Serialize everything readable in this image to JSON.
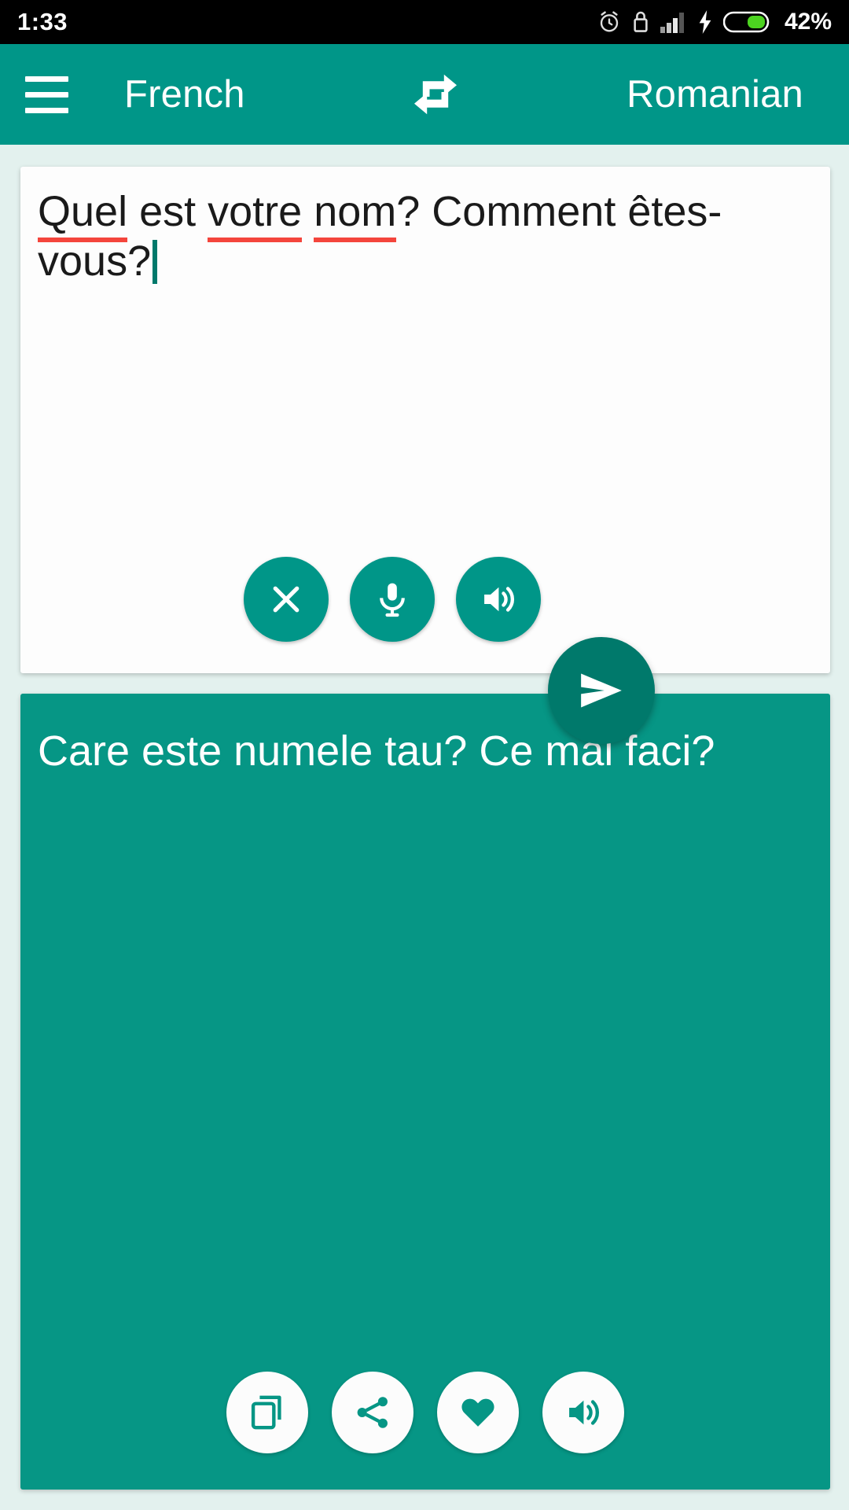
{
  "status_bar": {
    "time": "1:33",
    "battery_percent": "42%",
    "icons": [
      "alarm-icon",
      "lock-icon",
      "signal-bars-icon",
      "charging-bolt-icon",
      "battery-icon"
    ],
    "battery_fill_color": "#4CD320",
    "background": "#000000"
  },
  "app_bar": {
    "menu_icon": "hamburger-menu-icon",
    "source_language": "French",
    "swap_icon": "swap-languages-icon",
    "target_language": "Romanian",
    "background": "#009688"
  },
  "source_card": {
    "text_segments": [
      {
        "text": "Quel",
        "misspelled": true
      },
      {
        "text": " est ",
        "misspelled": false
      },
      {
        "text": "votre",
        "misspelled": true
      },
      {
        "text": " ",
        "misspelled": false
      },
      {
        "text": "nom",
        "misspelled": true
      },
      {
        "text": "? Comment ",
        "misspelled": false
      },
      {
        "text": "êtes-vous",
        "misspelled": true
      },
      {
        "text": "?",
        "misspelled": false
      }
    ],
    "full_text": "Quel est votre nom? Comment êtes-vous?",
    "spellcheck_underline_color": "#F4453C",
    "caret_color": "#00796B",
    "background": "#FDFDFD",
    "actions": [
      {
        "name": "clear-button",
        "icon": "close-icon",
        "label": "Clear"
      },
      {
        "name": "voice-input-button",
        "icon": "microphone-icon",
        "label": "Voice input"
      },
      {
        "name": "speak-source-button",
        "icon": "speaker-icon",
        "label": "Listen"
      }
    ]
  },
  "send_button": {
    "icon": "send-icon",
    "label": "Translate",
    "background": "#00796B"
  },
  "result_card": {
    "text": "Care este numele tau? Ce mai faci?",
    "background": "#069685",
    "text_color": "#FFFFFF",
    "actions": [
      {
        "name": "copy-button",
        "icon": "copy-icon",
        "label": "Copy"
      },
      {
        "name": "share-button",
        "icon": "share-icon",
        "label": "Share"
      },
      {
        "name": "favorite-button",
        "icon": "heart-icon",
        "label": "Favorite"
      },
      {
        "name": "speak-result-button",
        "icon": "speaker-icon",
        "label": "Listen"
      }
    ]
  },
  "page_background": "#E3F1EE"
}
